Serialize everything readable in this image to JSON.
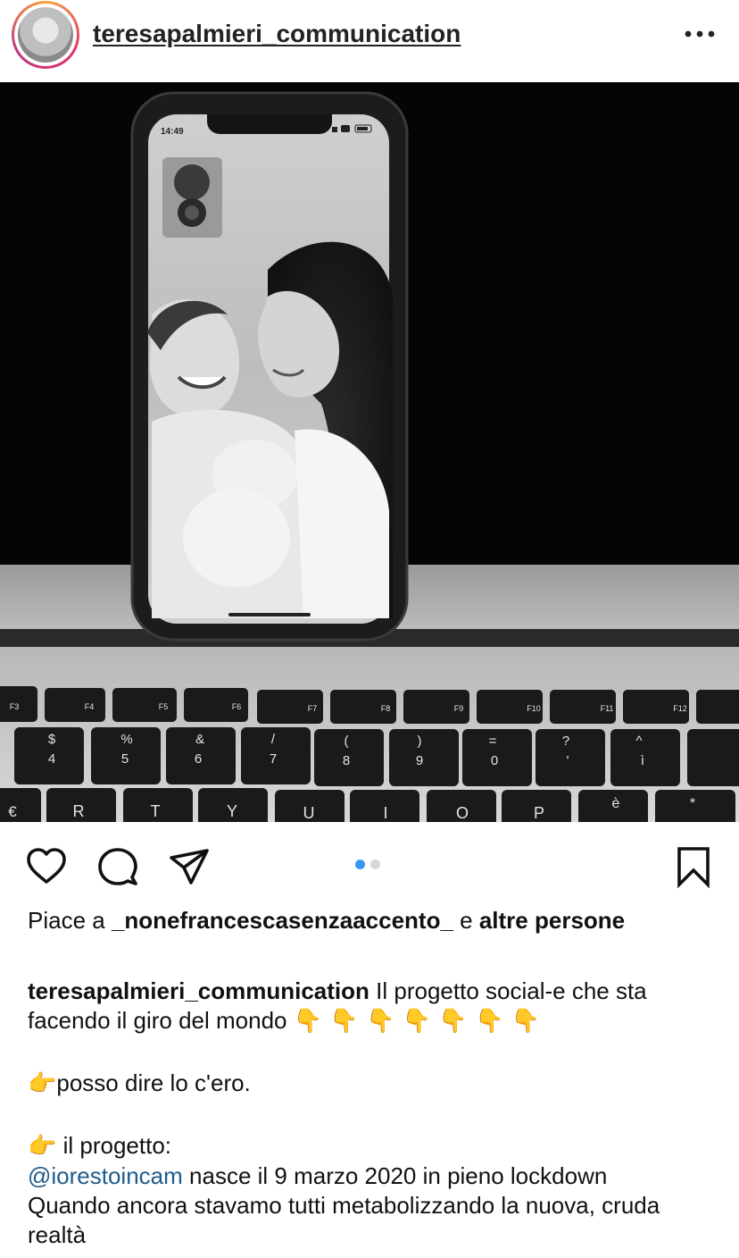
{
  "post": {
    "username": "teresapalmieri_communication",
    "phone_time": "14:49"
  },
  "keyboard": {
    "fn_row": [
      "F3",
      "F4",
      "F5",
      "F6",
      "F7",
      "F8",
      "F9",
      "F10",
      "F11",
      "F12"
    ],
    "num_row": [
      [
        "$",
        "4"
      ],
      [
        "%",
        "5"
      ],
      [
        "&",
        "6"
      ],
      [
        "/",
        "7"
      ],
      [
        "(",
        "8"
      ],
      [
        ")",
        "9"
      ],
      [
        "=",
        "0"
      ],
      [
        "?",
        "'"
      ],
      [
        "^",
        "ì"
      ]
    ],
    "letter_row": [
      "€",
      "R",
      "T",
      "Y",
      "U",
      "I",
      "O",
      "P",
      "è",
      "*"
    ]
  },
  "likes": {
    "prefix": "Piace a ",
    "user": "_nonefrancescasenzaaccento_",
    "middle": " e ",
    "others": "altre persone"
  },
  "caption": {
    "author": "teresapalmieri_communication",
    "line1": " Il progetto social-e che sta facendo il giro del mondo ",
    "pointing_down": "👇 👇 👇 👇 👇 👇 👇",
    "p2_emoji": "👉",
    "p2_text": "posso dire lo c'ero.",
    "p3_emoji": "👉",
    "p3_text": " il progetto:",
    "mention": "@iorestoincam",
    "line4": "  nasce il 9 marzo 2020 in pieno lockdown",
    "line5": "Quando ancora stavamo tutti metabolizzando la nuova, cruda realtà"
  },
  "carousel": {
    "count": 2,
    "active": 1
  },
  "colors": {
    "accent": "#3897f0",
    "mention": "#1f5c8c"
  },
  "icons": [
    "more-options-icon",
    "heart-icon",
    "comment-icon",
    "share-icon",
    "bookmark-icon"
  ]
}
